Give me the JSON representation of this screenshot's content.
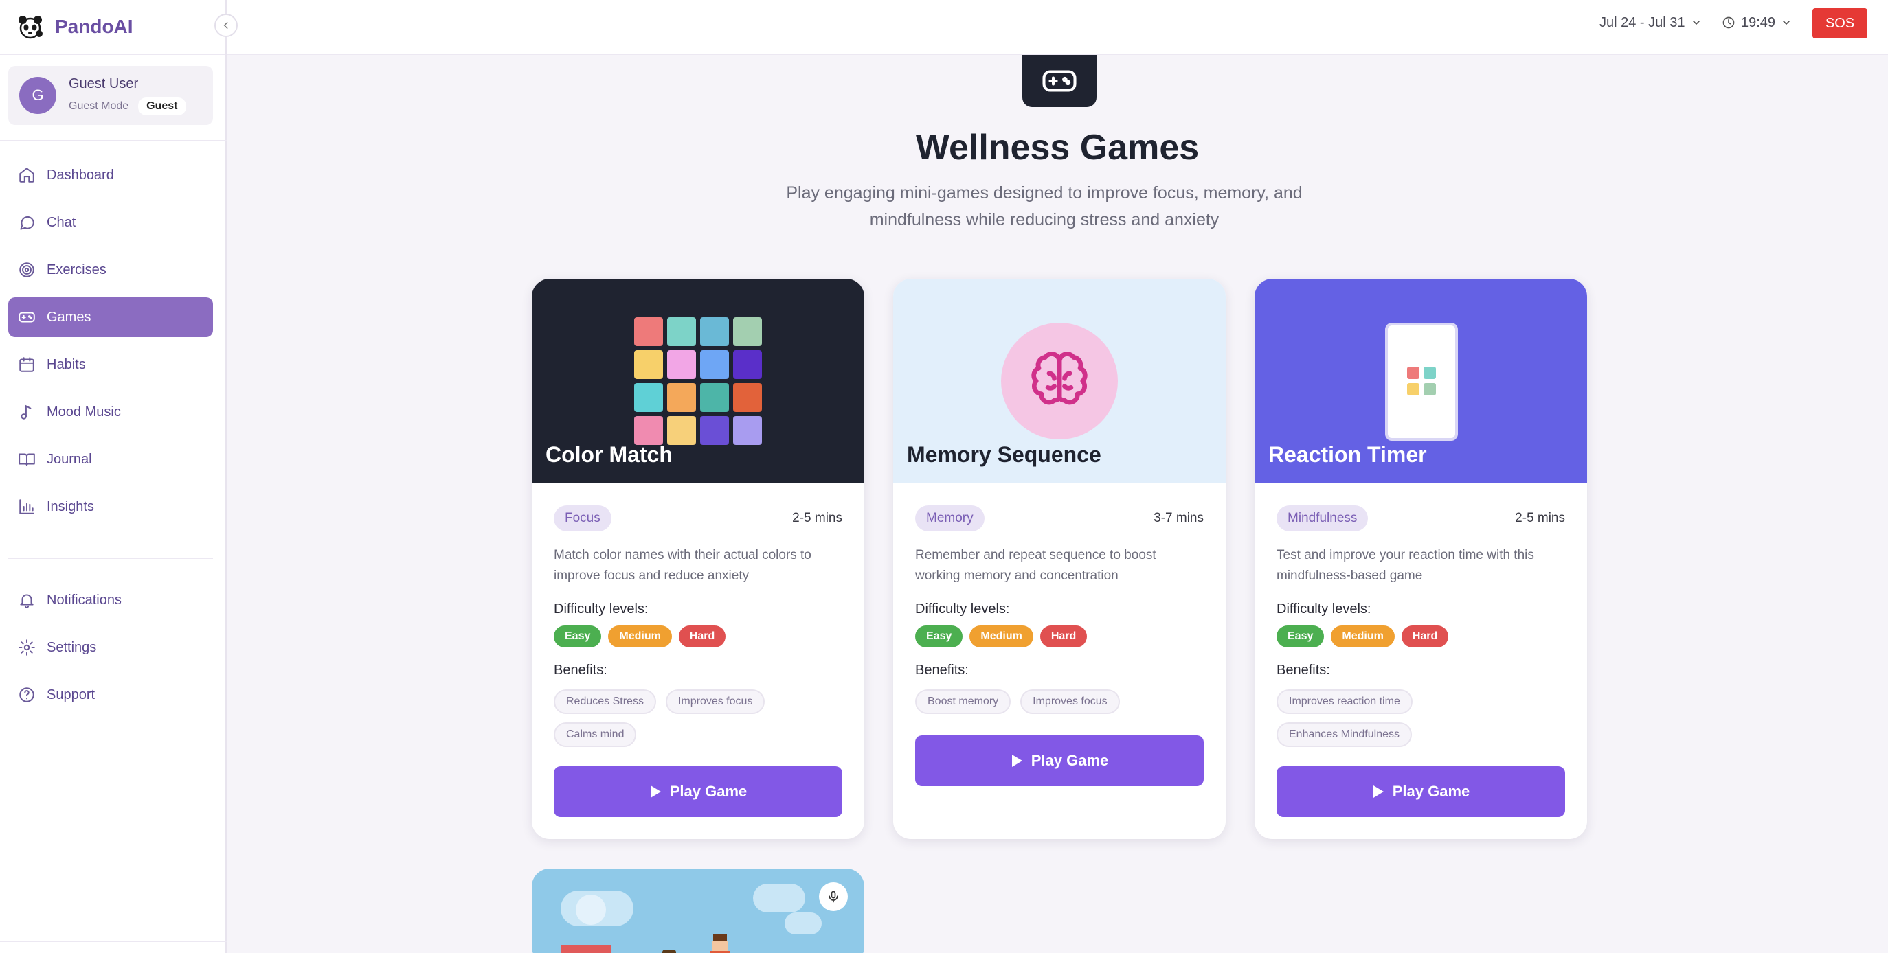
{
  "app": {
    "name": "PandoAI"
  },
  "user": {
    "initial": "G",
    "name": "Guest User",
    "mode": "Guest Mode",
    "badge": "Guest"
  },
  "nav": {
    "items": [
      {
        "label": "Dashboard",
        "icon": "home-icon"
      },
      {
        "label": "Chat",
        "icon": "chat-icon"
      },
      {
        "label": "Exercises",
        "icon": "target-icon"
      },
      {
        "label": "Games",
        "icon": "gamepad-icon",
        "active": true
      },
      {
        "label": "Habits",
        "icon": "calendar-icon"
      },
      {
        "label": "Mood Music",
        "icon": "music-note-icon"
      },
      {
        "label": "Journal",
        "icon": "book-icon"
      },
      {
        "label": "Insights",
        "icon": "bar-chart-icon"
      }
    ],
    "secondary": [
      {
        "label": "Notifications",
        "icon": "bell-icon"
      },
      {
        "label": "Settings",
        "icon": "gear-icon"
      },
      {
        "label": "Support",
        "icon": "help-circle-icon"
      }
    ]
  },
  "header": {
    "date_range": "Jul 24 - Jul 31",
    "time": "19:49",
    "sos_label": "SOS"
  },
  "page": {
    "title": "Wellness Games",
    "subtitle": "Play engaging mini-games designed to improve focus, memory, and mindfulness while reducing stress and anxiety"
  },
  "labels": {
    "difficulty": "Difficulty levels:",
    "benefits": "Benefits:",
    "play": "Play Game"
  },
  "games": [
    {
      "title": "Color Match",
      "category": "Focus",
      "duration": "2-5 mins",
      "description": "Match color names with their actual colors to improve focus and reduce anxiety",
      "difficulty": [
        "Easy",
        "Medium",
        "Hard"
      ],
      "benefits": [
        "Reduces Stress",
        "Improves focus",
        "Calms mind"
      ]
    },
    {
      "title": "Memory Sequence",
      "category": "Memory",
      "duration": "3-7 mins",
      "description": "Remember and repeat sequence to boost working memory and concentration",
      "difficulty": [
        "Easy",
        "Medium",
        "Hard"
      ],
      "benefits": [
        "Boost memory",
        "Improves focus"
      ]
    },
    {
      "title": "Reaction Timer",
      "category": "Mindfulness",
      "duration": "2-5 mins",
      "description": "Test and improve your reaction time with this mindfulness-based game",
      "difficulty": [
        "Easy",
        "Medium",
        "Hard"
      ],
      "benefits": [
        "Improves reaction time",
        "Enhances Mindfulness"
      ]
    }
  ],
  "colors": {
    "brand": "#6a4fa3",
    "active_nav": "#8b6cc1",
    "play_button": "#8258e6",
    "sos": "#e53935",
    "color_match_grid": [
      "#ee7a7a",
      "#7dd3c8",
      "#6ab9d6",
      "#a3cfb0",
      "#f7d06a",
      "#f2a6e6",
      "#6ea6f5",
      "#5a2fc9",
      "#5fd0d6",
      "#f4a85a",
      "#4db5a8",
      "#e2623a",
      "#f08bb0",
      "#f7d07a",
      "#6a4fd6",
      "#a89cf0"
    ]
  }
}
